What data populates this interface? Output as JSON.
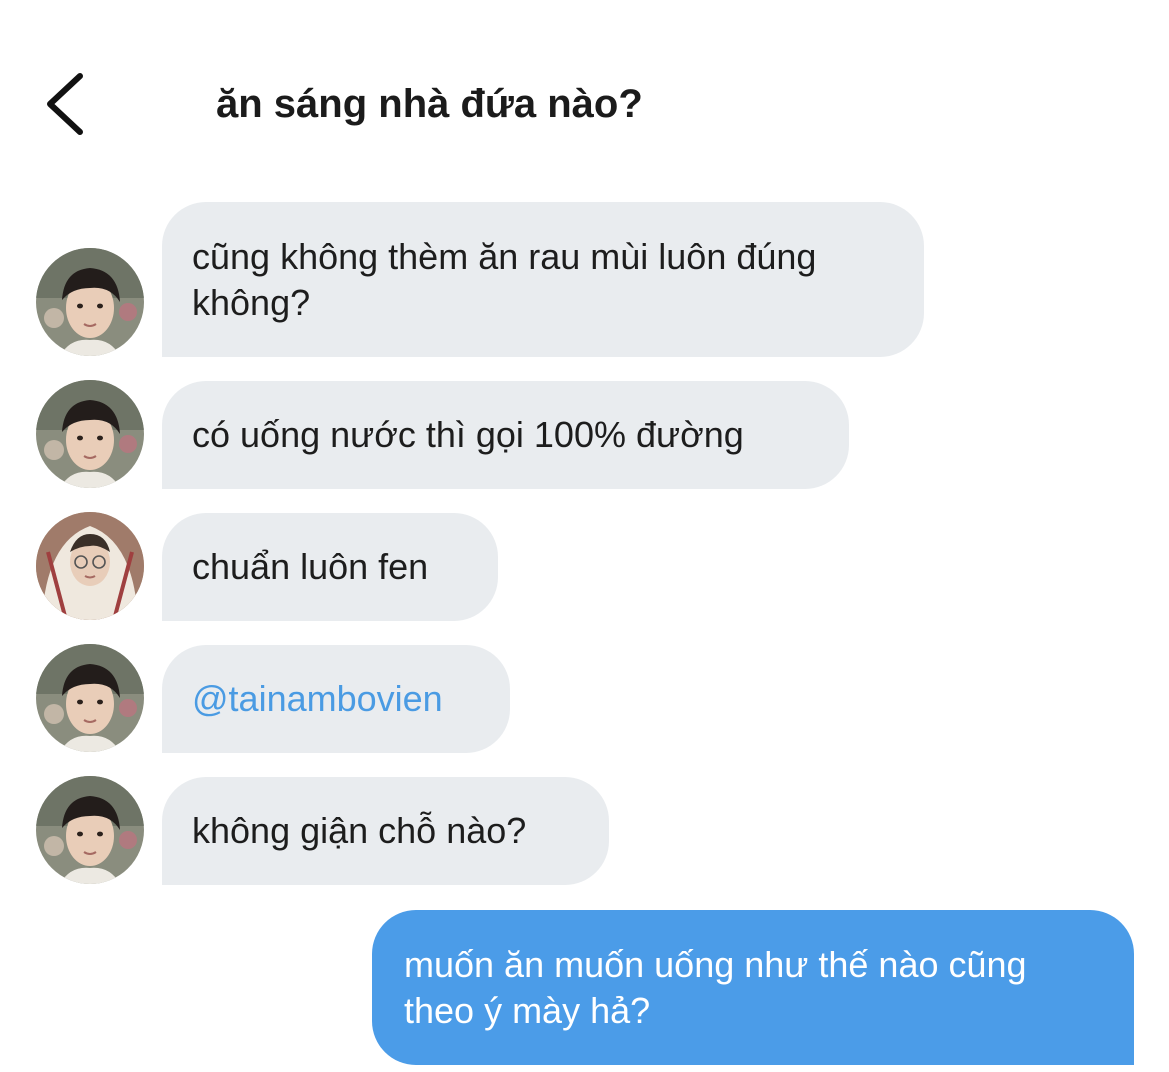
{
  "header": {
    "back_icon": "chevron-left-icon",
    "title": "ăn sáng nhà đứa nào?"
  },
  "colors": {
    "incoming_bubble": "#e9ecef",
    "outgoing_bubble": "#4b9ce8",
    "mention": "#4a9be3"
  },
  "messages": [
    {
      "sender": "other",
      "avatar": "avatar-a",
      "text": "cũng không thèm ăn rau mùi luôn đúng không?"
    },
    {
      "sender": "other",
      "avatar": "avatar-a",
      "text": "có uống nước thì gọi 100% đường"
    },
    {
      "sender": "other",
      "avatar": "avatar-b",
      "text": "chuẩn luôn fen"
    },
    {
      "sender": "other",
      "avatar": "avatar-a",
      "text": "@tainambovien"
    },
    {
      "sender": "other",
      "avatar": "avatar-a",
      "text": "không giận chỗ nào?"
    },
    {
      "sender": "me",
      "text": "muốn ăn muốn uống như thế nào cũng theo ý mày hả?"
    }
  ]
}
